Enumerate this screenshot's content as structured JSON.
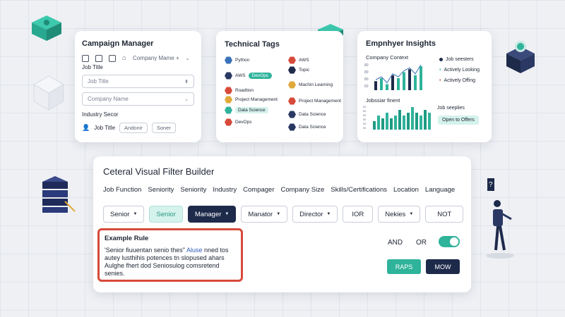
{
  "campaign": {
    "title": "Campaign Manager",
    "company_select": "Company Mame +",
    "job_title_label": "Job Title",
    "job_title_placeholder": "Job Title",
    "company_name_placeholder": "Company Name",
    "industry_label": "Industry Secor",
    "job_title_row": "Job Title",
    "select1": "Andonir",
    "select2": "Soner"
  },
  "tags": {
    "title": "Technical Tags",
    "items": [
      "Python",
      "AWS",
      "DevOps",
      "Roadtion",
      "Project Management",
      "Data Science",
      "DevOps"
    ],
    "right_items": [
      "AWS",
      "Topic",
      "Machin Learning",
      "Project Management",
      "Data Science",
      "Data Science"
    ]
  },
  "insights": {
    "title": "Empnhyer Insights",
    "company_context": "Company Context",
    "legend": [
      "Job seesters",
      "Actively Looking",
      "Actively Offing"
    ],
    "second_label": "Jobssiar finent",
    "job_seeplies": "Job seeplies",
    "open_offers": "Open to Offers",
    "chart1_values": [
      3,
      4,
      2,
      5,
      4,
      6,
      7,
      5,
      8
    ],
    "chart2_values": [
      3,
      5,
      4,
      6,
      4,
      5,
      7,
      5,
      6,
      8,
      6,
      5,
      7,
      6
    ],
    "chart1_ticks": [
      "80",
      "80",
      "80",
      "60"
    ],
    "chart2_ticks": [
      "50",
      "50",
      "50",
      "50",
      "50",
      "50"
    ]
  },
  "builder": {
    "title": "Ceteral Visual Filter Builder",
    "categories": [
      "Job Function",
      "Seniority",
      "Seniority",
      "Industry",
      "Compager",
      "Company Size",
      "Skills/Certifications",
      "Location",
      "Language"
    ],
    "filters": [
      "Senior",
      "Senior",
      "Manager",
      "Manator",
      "Director",
      "IOR",
      "Nekies",
      "NOT"
    ],
    "rule_title": "Example Rule",
    "rule_line1a": "'Senior fiuuentan senio thes\"",
    "rule_line1b": " Aluse",
    "rule_line1c": " nned tos",
    "rule_line2": "autey lusthihis potences tn slopused ahars",
    "rule_line3": "Aulghe fhert dod Seniosulog comsretend",
    "rule_line4": "senies.",
    "and_label": "AND",
    "or_label": "OR",
    "btn1": "RAPS",
    "btn2": "MOW"
  },
  "colors": {
    "teal": "#2fb39b",
    "navy": "#1e2a4a",
    "red": "#d64a3a"
  }
}
